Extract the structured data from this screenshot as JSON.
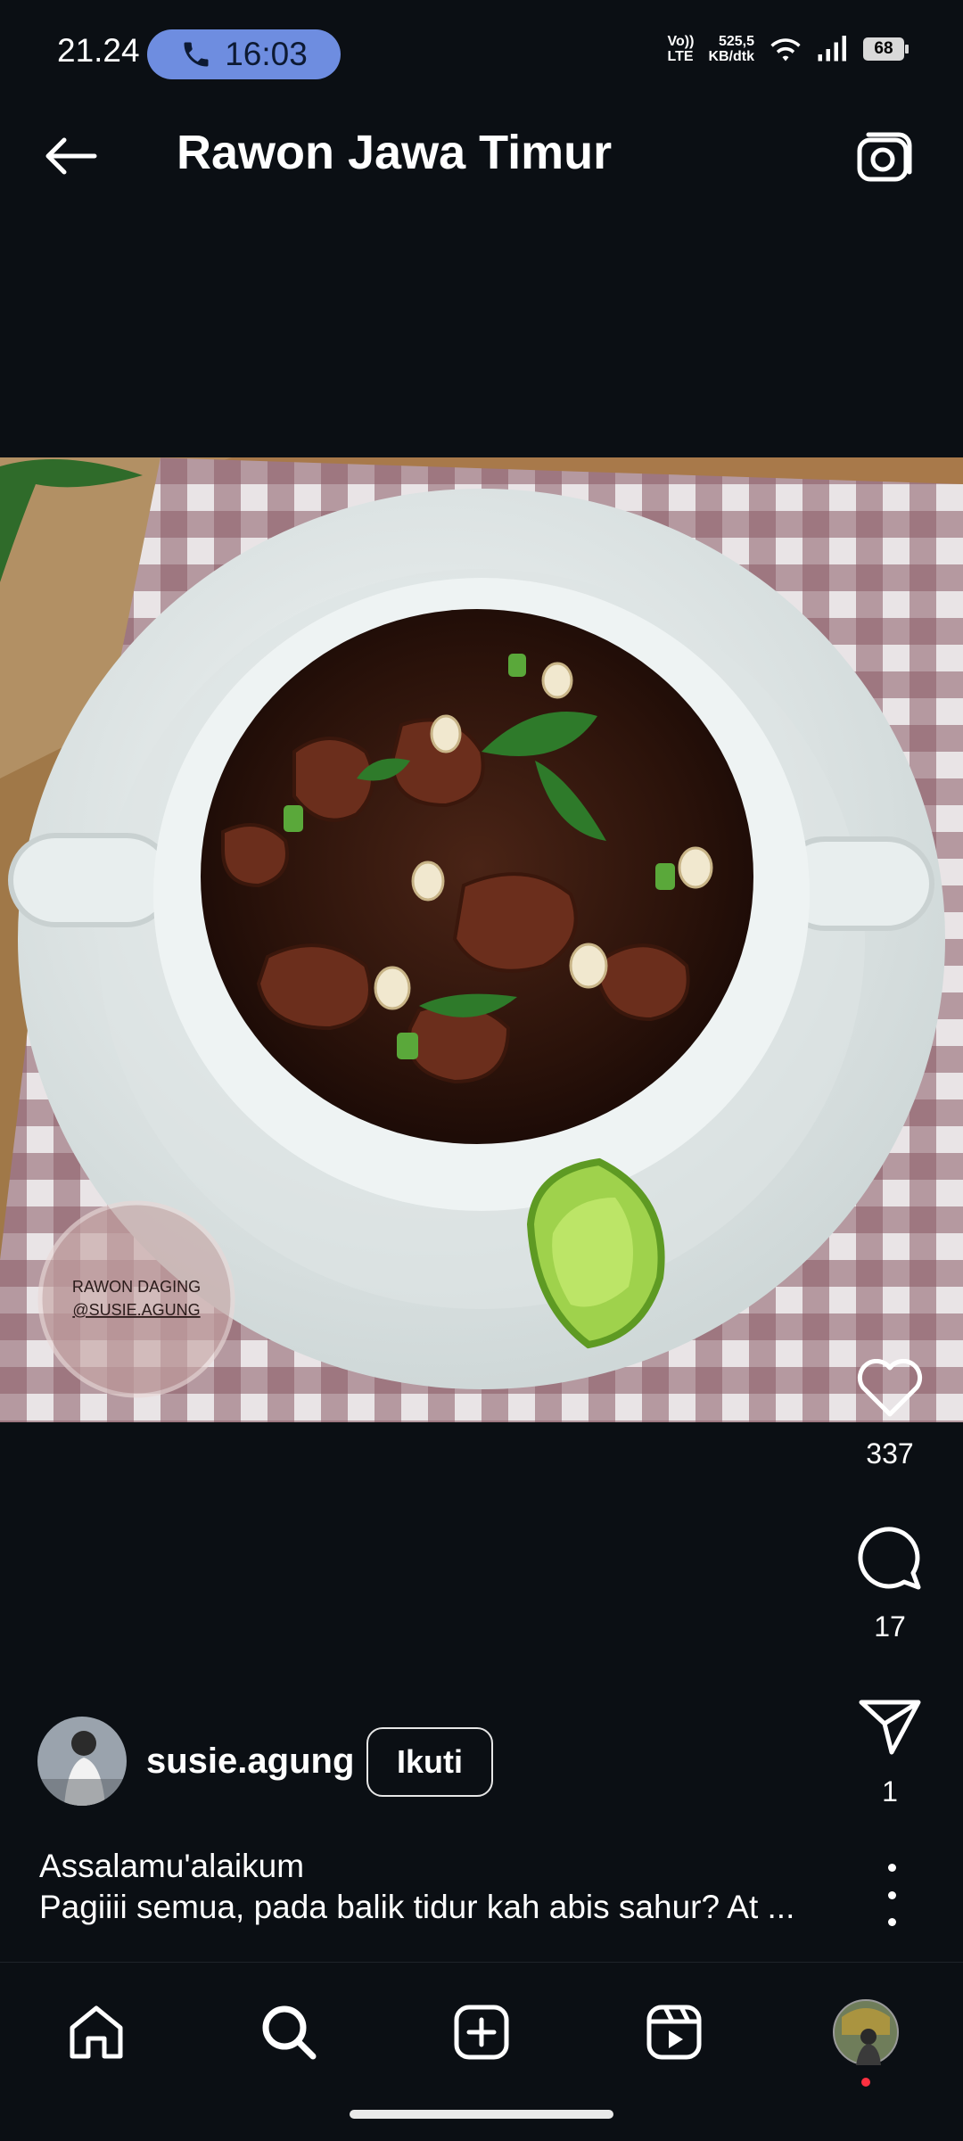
{
  "status_bar": {
    "time": "21.24",
    "call_timer": "16:03",
    "volte_label_top": "Vo))",
    "volte_label_bottom": "LTE",
    "speed_value": "525,5",
    "speed_unit": "KB/dtk",
    "battery": "68"
  },
  "header": {
    "title": "Rawon Jawa Timur"
  },
  "post": {
    "watermark_line1": "RAWON DAGING",
    "watermark_line2": "@SUSIE.AGUNG",
    "likes": "337",
    "comments": "17",
    "shares": "1",
    "author": "susie.agung",
    "follow_label": "Ikuti",
    "caption_line1": "Assalamu'alaikum",
    "caption_line2": "Pagiiii semua, pada balik tidur kah abis sahur? At ..."
  },
  "nav": {
    "items": [
      "home-icon",
      "search-icon",
      "create-icon",
      "reels-icon",
      "profile-avatar"
    ]
  },
  "colors": {
    "background": "#0b0f14",
    "call_pill": "#6e8de0",
    "notification_dot": "#ff3040"
  }
}
